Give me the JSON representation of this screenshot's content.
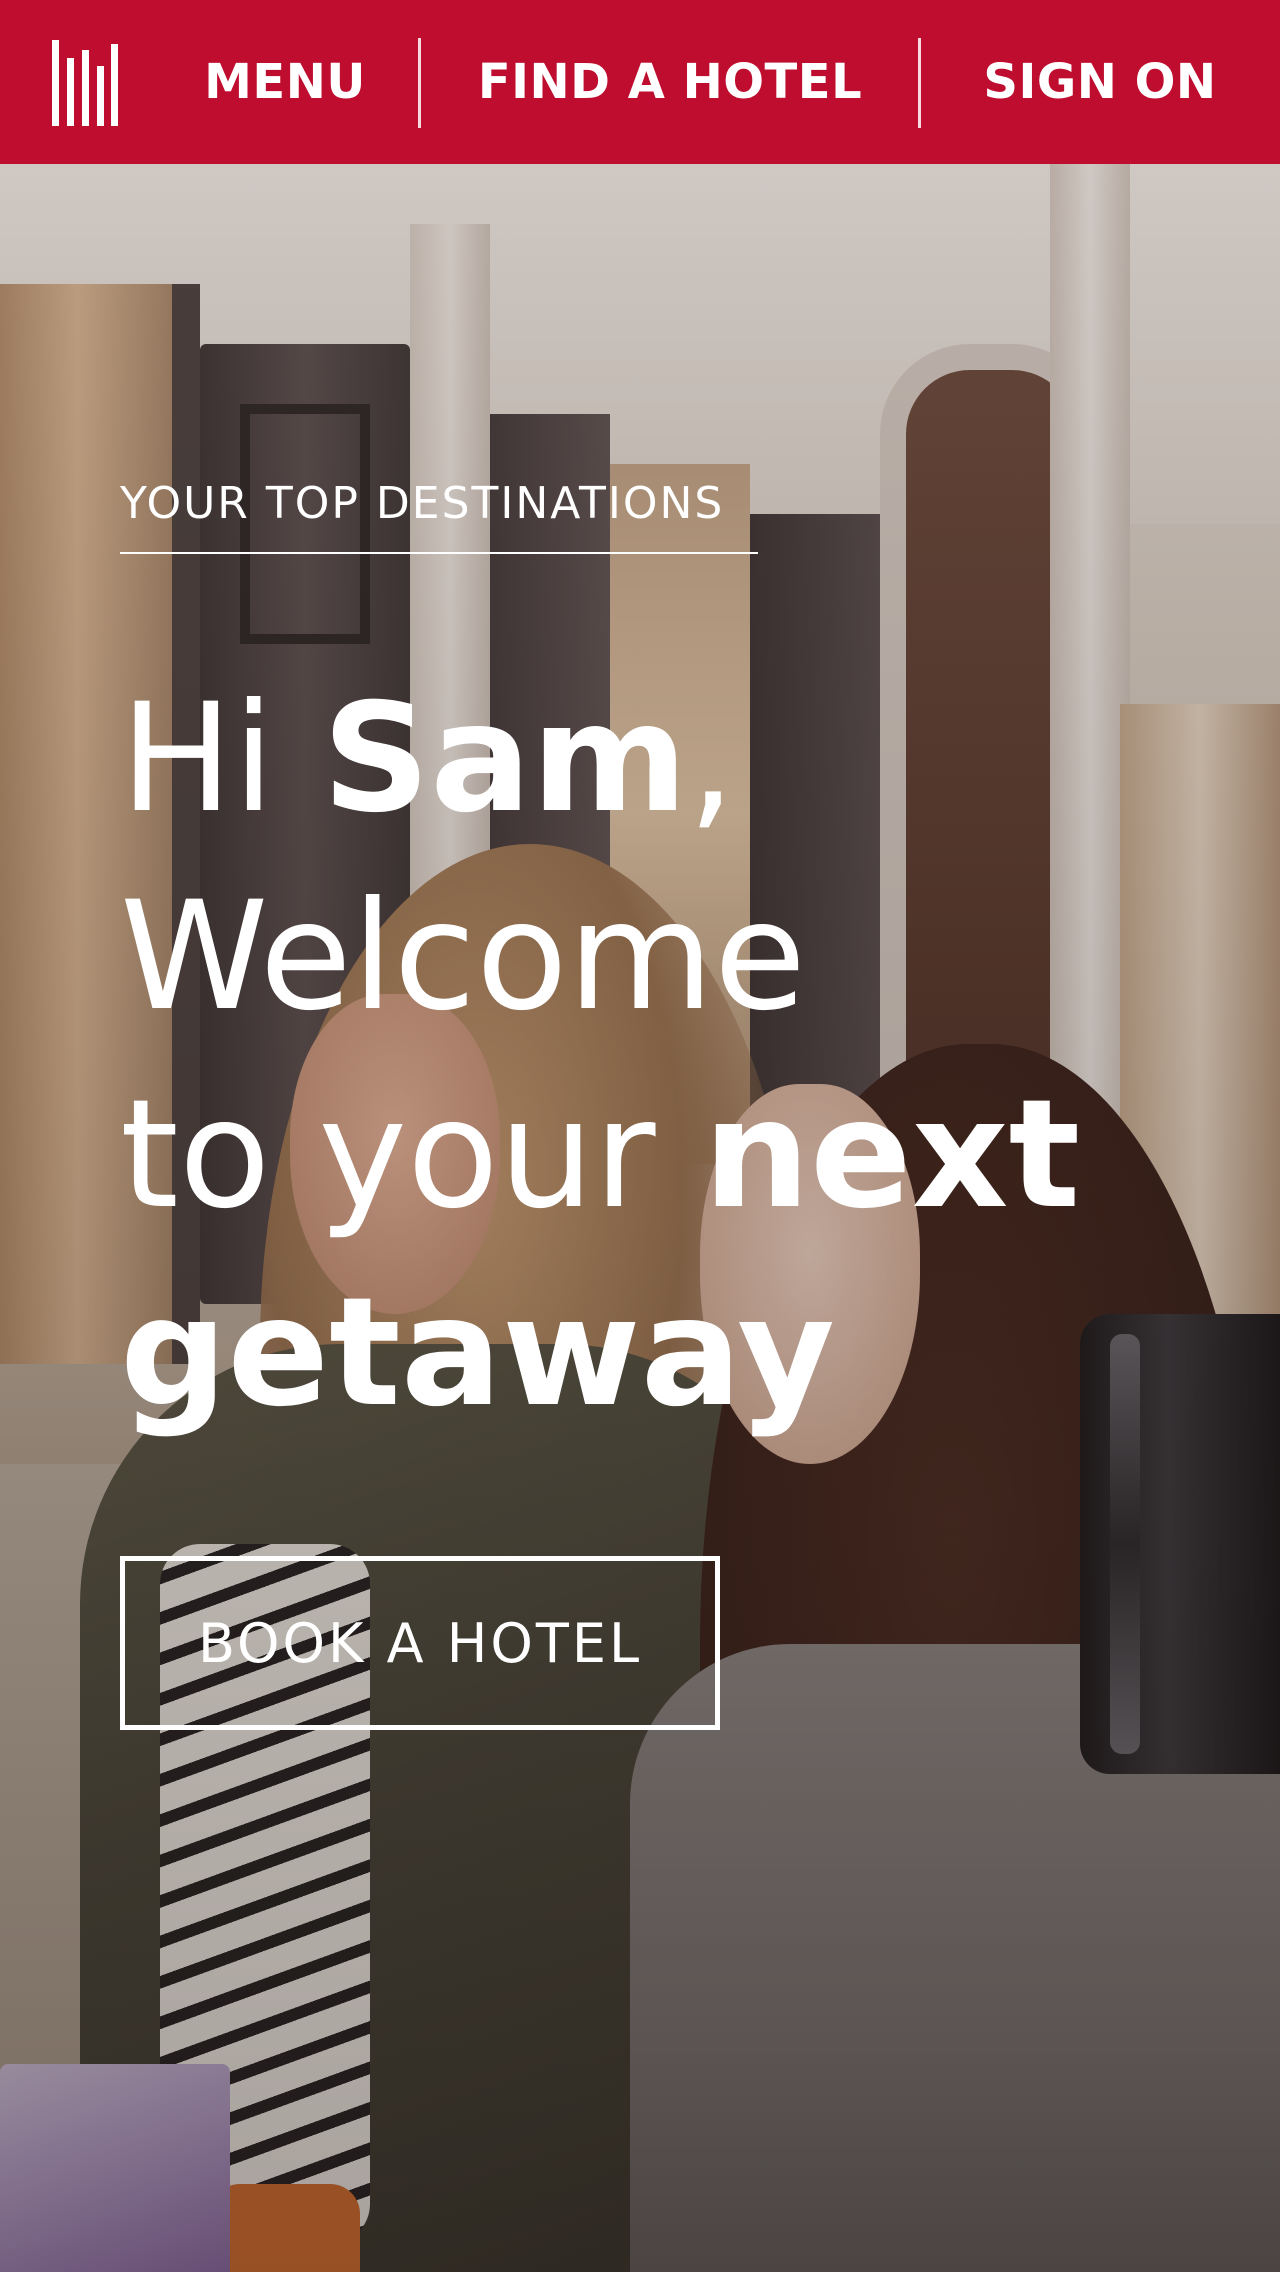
{
  "nav": {
    "logo_icon": "brand-bars-logo",
    "items": [
      {
        "label": "MENU"
      },
      {
        "label": "FIND A HOTEL"
      },
      {
        "label": "SIGN ON"
      }
    ]
  },
  "hero": {
    "eyebrow": "YOUR TOP DESTINATIONS",
    "headline": {
      "line1_thin": "Hi ",
      "line1_bold": "Sam",
      "line1_tail": ",",
      "line2": "Welcome",
      "line3_thin": "to your ",
      "line3_bold": "next",
      "line4_bold": "getaway"
    },
    "cta_label": "BOOK A HOTEL"
  },
  "colors": {
    "brand_red": "#bf0d30",
    "text_on_brand": "#ffffff"
  }
}
